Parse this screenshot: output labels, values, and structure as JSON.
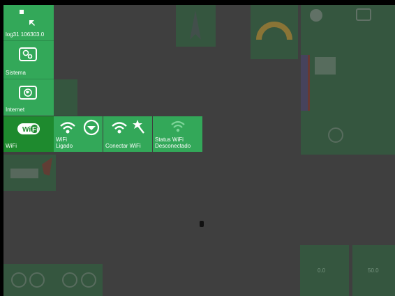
{
  "top_tile": {
    "label": "log31 106303.0"
  },
  "menu": [
    {
      "label": "Sistema",
      "icon": "gears-icon"
    },
    {
      "label": "Internet",
      "icon": "globe-icon"
    },
    {
      "label": "WiFi",
      "icon": "wifi-icon"
    }
  ],
  "submenu": [
    {
      "line1": "WiFi",
      "line2": "Ligado",
      "icon": "wifi-dropdown-icon"
    },
    {
      "line1": "Conectar WiFi",
      "line2": "",
      "icon": "wifi-magic-icon"
    },
    {
      "line1": "Status WiFi",
      "line2": "Desconectado",
      "icon": "wifi-status-icon"
    }
  ],
  "gauges": {
    "left_value": "0.0",
    "right_value": "50.0"
  },
  "colors": {
    "background": "#3f3f3f",
    "tile_green": "#33a859",
    "selected_green": "#1e8a2e"
  }
}
